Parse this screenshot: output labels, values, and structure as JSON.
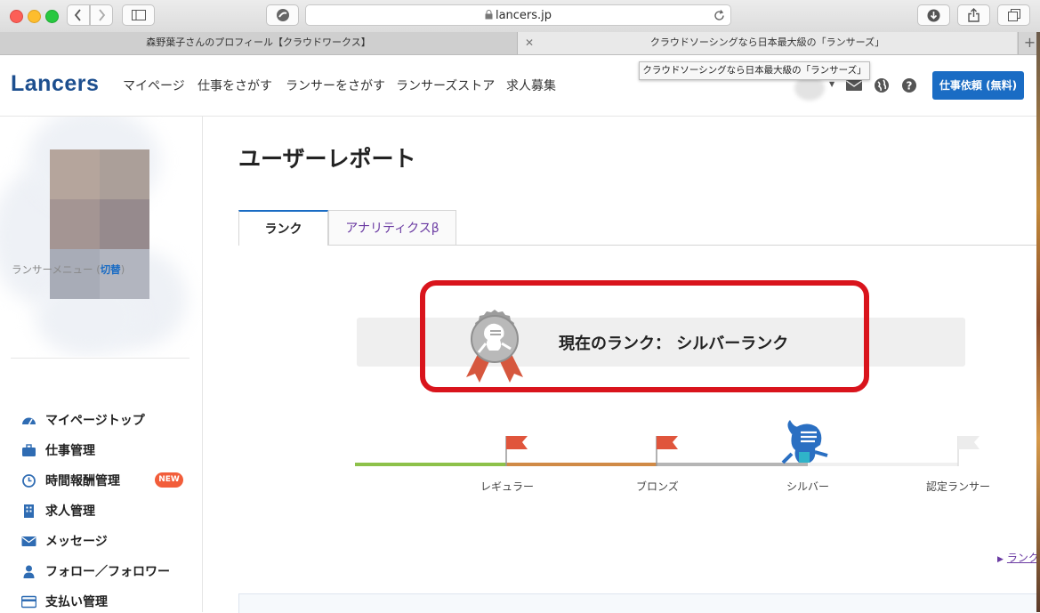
{
  "browser": {
    "url": "lancers.jp",
    "tabs": [
      {
        "label": "森野葉子さんのプロフィール【クラウドワークス】"
      },
      {
        "label": "クラウドソーシングなら日本最大級の「ランサーズ」"
      }
    ],
    "tooltip": "クラウドソーシングなら日本最大級の「ランサーズ」"
  },
  "header": {
    "logo": "Lancers",
    "nav": [
      "マイページ",
      "仕事をさがす",
      "ランサーをさがす",
      "ランサーズストア",
      "求人募集"
    ],
    "cta": "仕事依頼 (無料)"
  },
  "sidebar": {
    "menu_title": "ランサーメニュー (",
    "menu_switch": "切替",
    "menu_title_end": ")",
    "items": [
      {
        "label": "マイページトップ",
        "icon": "dashboard-icon"
      },
      {
        "label": "仕事管理",
        "icon": "briefcase-icon"
      },
      {
        "label": "時間報酬管理",
        "icon": "clock-icon",
        "badge": "NEW"
      },
      {
        "label": "求人管理",
        "icon": "building-icon"
      },
      {
        "label": "メッセージ",
        "icon": "envelope-icon"
      },
      {
        "label": "フォロー／フォロワー",
        "icon": "person-icon"
      },
      {
        "label": "支払い管理",
        "icon": "credit-card-icon"
      }
    ]
  },
  "main": {
    "title": "ユーザーレポート",
    "tabs": [
      "ランク",
      "アナリティクスβ"
    ],
    "current_rank": "現在のランク： シルバーランク",
    "levels": [
      "レギュラー",
      "ブロンズ",
      "シルバー",
      "認定ランサー"
    ],
    "rank_link": "ランク"
  },
  "colors": {
    "accent": "#1a6cc4",
    "highlight": "#d9141c",
    "regular": "#8dc14a",
    "bronze": "#d08a46",
    "silver": "#b5b5b5",
    "flag": "#e0553c"
  }
}
